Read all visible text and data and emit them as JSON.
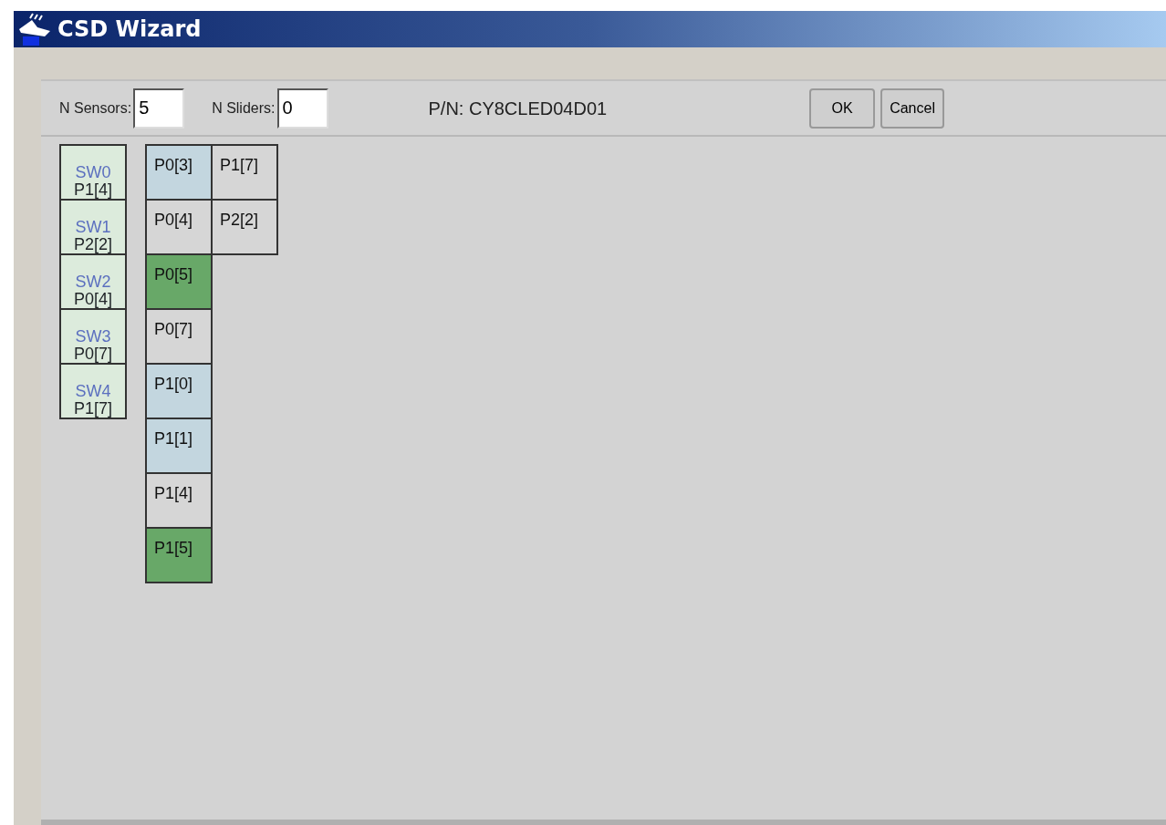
{
  "window": {
    "title": "CSD Wizard"
  },
  "toolbar": {
    "n_sensors": {
      "label": "N Sensors:",
      "value": "5"
    },
    "n_sliders": {
      "label": "N Sliders:",
      "value": "0"
    },
    "part_number": "P/N: CY8CLED04D01",
    "buttons": [
      {
        "label": "OK"
      },
      {
        "label": "Cancel"
      }
    ]
  },
  "sensors": [
    {
      "name": "SW0",
      "pin": "P1[4]"
    },
    {
      "name": "SW1",
      "pin": "P2[2]"
    },
    {
      "name": "SW2",
      "pin": "P0[4]"
    },
    {
      "name": "SW3",
      "pin": "P0[7]"
    },
    {
      "name": "SW4",
      "pin": "P1[7]"
    }
  ],
  "pin_rows": [
    [
      {
        "label": "P0[3]",
        "color": "#c3d6df"
      },
      {
        "label": "P1[7]",
        "color": "#d6d6d6"
      }
    ],
    [
      {
        "label": "P0[4]",
        "color": "#d6d6d6"
      },
      {
        "label": "P2[2]",
        "color": "#d6d6d6"
      }
    ],
    [
      {
        "label": "P0[5]",
        "color": "#68a868"
      }
    ],
    [
      {
        "label": "P0[7]",
        "color": "#d6d6d6"
      }
    ],
    [
      {
        "label": "P1[0]",
        "color": "#c3d6df"
      }
    ],
    [
      {
        "label": "P1[1]",
        "color": "#c3d6df"
      }
    ],
    [
      {
        "label": "P1[4]",
        "color": "#d6d6d6"
      }
    ],
    [
      {
        "label": "P1[5]",
        "color": "#68a868"
      }
    ]
  ]
}
